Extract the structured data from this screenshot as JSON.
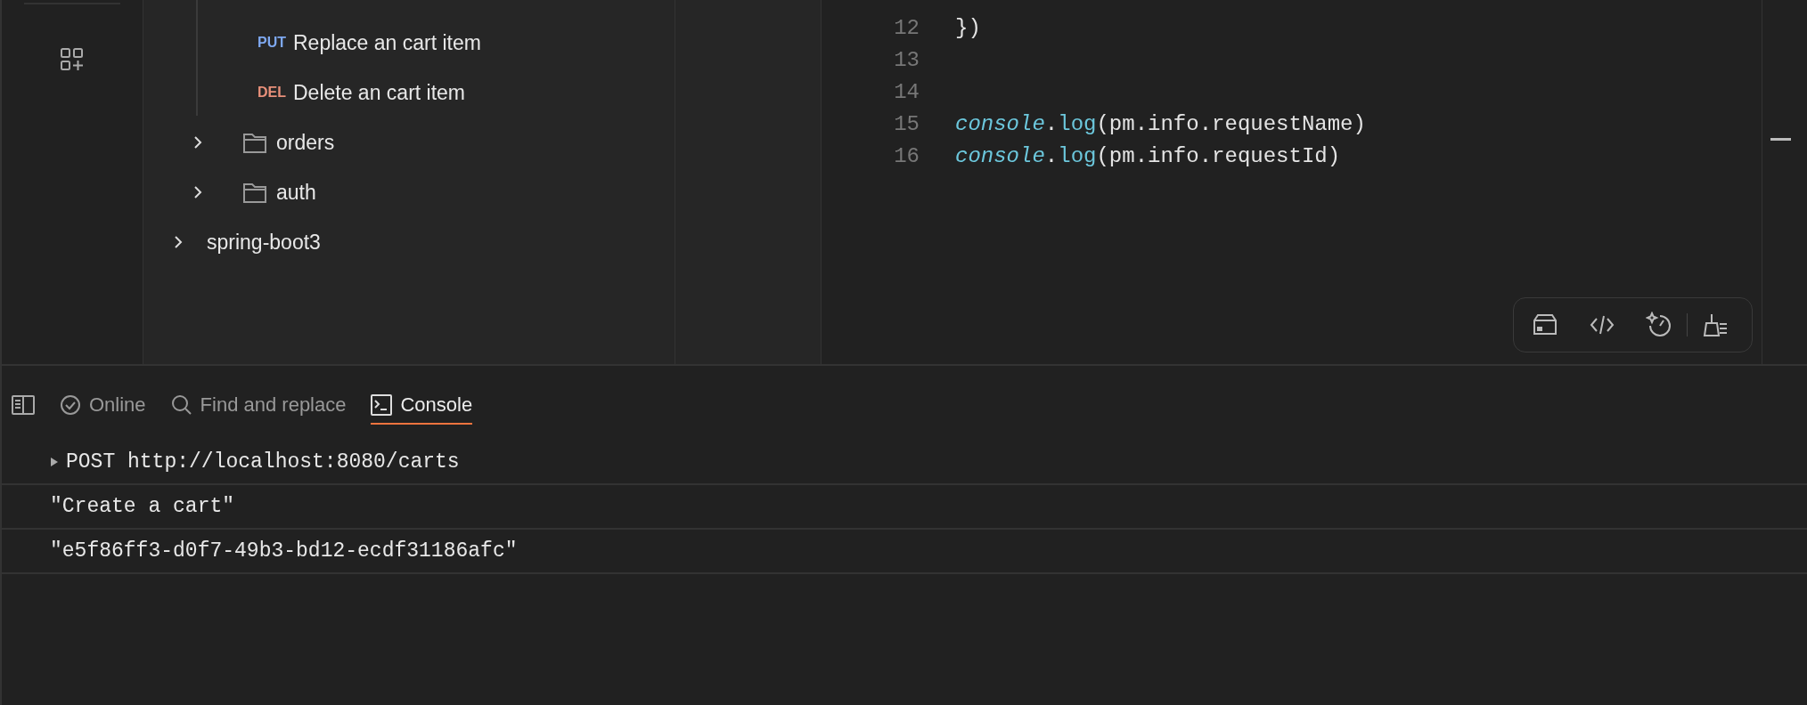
{
  "sidebar": {
    "tree": [
      {
        "kind": "collection",
        "children": [
          {
            "kind": "folder",
            "children": [
              {
                "kind": "request",
                "method": "PUT",
                "color": "#7ea8f0",
                "label": "Replace an cart item"
              },
              {
                "kind": "request",
                "method": "DEL",
                "color": "#e8907a",
                "label": "Delete an cart item"
              }
            ]
          },
          {
            "kind": "folder",
            "label": "orders",
            "expanded": false
          },
          {
            "kind": "folder",
            "label": "auth",
            "expanded": false
          }
        ]
      },
      {
        "kind": "collection",
        "label": "spring-boot3",
        "expanded": false
      }
    ]
  },
  "editor": {
    "lines": [
      {
        "number": "12",
        "tokens": [
          {
            "kind": "plain",
            "text": "})"
          }
        ]
      },
      {
        "number": "13"
      },
      {
        "number": "14"
      },
      {
        "number": "15",
        "tokens": [
          {
            "kind": "object",
            "text": "console"
          },
          {
            "kind": "plain",
            "text": "."
          },
          {
            "kind": "function",
            "text": "log"
          },
          {
            "kind": "plain",
            "text": "(pm.info.requestName)"
          }
        ]
      },
      {
        "number": "16",
        "tokens": [
          {
            "kind": "object",
            "text": "console"
          },
          {
            "kind": "plain",
            "text": "."
          },
          {
            "kind": "function",
            "text": "log"
          },
          {
            "kind": "plain",
            "text": "(pm.info.requestId)"
          }
        ]
      }
    ]
  },
  "console": {
    "tabs": [
      {
        "kind": "status",
        "label": "Online",
        "selected": false
      },
      {
        "kind": "search",
        "label": "Find and replace",
        "selected": false
      },
      {
        "kind": "terminal",
        "label": "Console",
        "selected": true
      }
    ],
    "logs": [
      {
        "kind": "request",
        "text": "POST http://localhost:8080/carts"
      },
      {
        "kind": "value",
        "text": "\"Create a cart\""
      },
      {
        "kind": "value",
        "text": "\"e5f86ff3-d0f7-49b3-bd12-ecdf31186afc\""
      }
    ]
  }
}
